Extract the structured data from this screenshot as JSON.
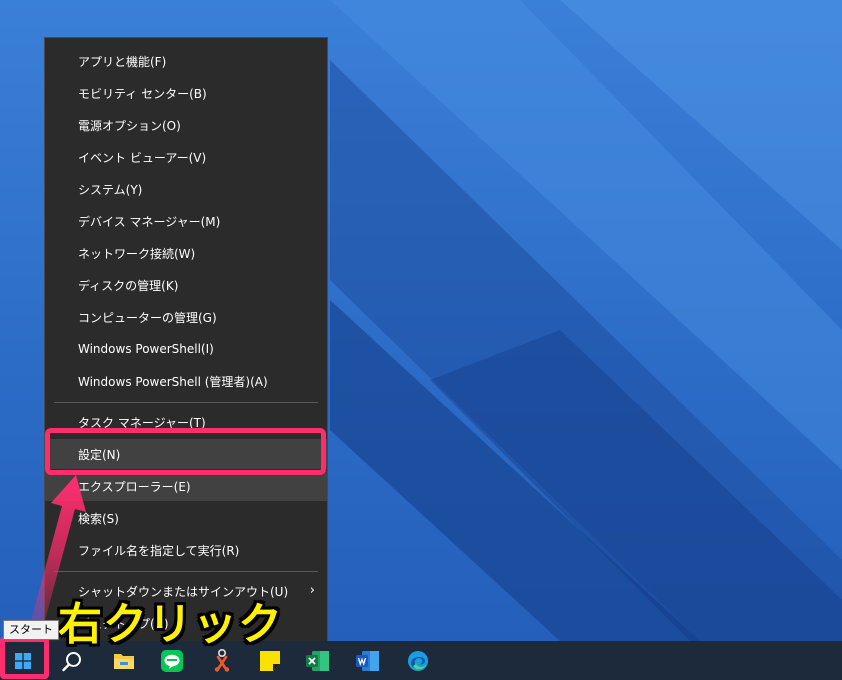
{
  "context_menu": {
    "items": [
      {
        "label": "アプリと機能(F)"
      },
      {
        "label": "モビリティ センター(B)"
      },
      {
        "label": "電源オプション(O)"
      },
      {
        "label": "イベント ビューアー(V)"
      },
      {
        "label": "システム(Y)"
      },
      {
        "label": "デバイス マネージャー(M)"
      },
      {
        "label": "ネットワーク接続(W)"
      },
      {
        "label": "ディスクの管理(K)"
      },
      {
        "label": "コンピューターの管理(G)"
      },
      {
        "label": "Windows PowerShell(I)"
      },
      {
        "label": "Windows PowerShell (管理者)(A)"
      },
      {
        "label": "タスク マネージャー(T)"
      },
      {
        "label": "設定(N)"
      },
      {
        "label": "エクスプローラー(E)"
      },
      {
        "label": "検索(S)"
      },
      {
        "label": "ファイル名を指定して実行(R)"
      },
      {
        "label": "シャットダウンまたはサインアウト(U)"
      },
      {
        "label": "デスクトップ(D)"
      }
    ],
    "submenu_arrow": "›"
  },
  "annotation": {
    "text": "右クリック",
    "color": "#fff200",
    "highlight_color": "#ff2d6e"
  },
  "tooltip": {
    "text": "スタート"
  },
  "taskbar": {
    "background": "#1d2a3b",
    "icons": [
      "windows-start-icon",
      "search-icon",
      "file-explorer-icon",
      "line-app-icon",
      "snipping-tool-icon",
      "sticky-notes-icon",
      "excel-icon",
      "word-icon",
      "edge-icon"
    ]
  },
  "desktop": {
    "background": "#2f6ec4"
  }
}
